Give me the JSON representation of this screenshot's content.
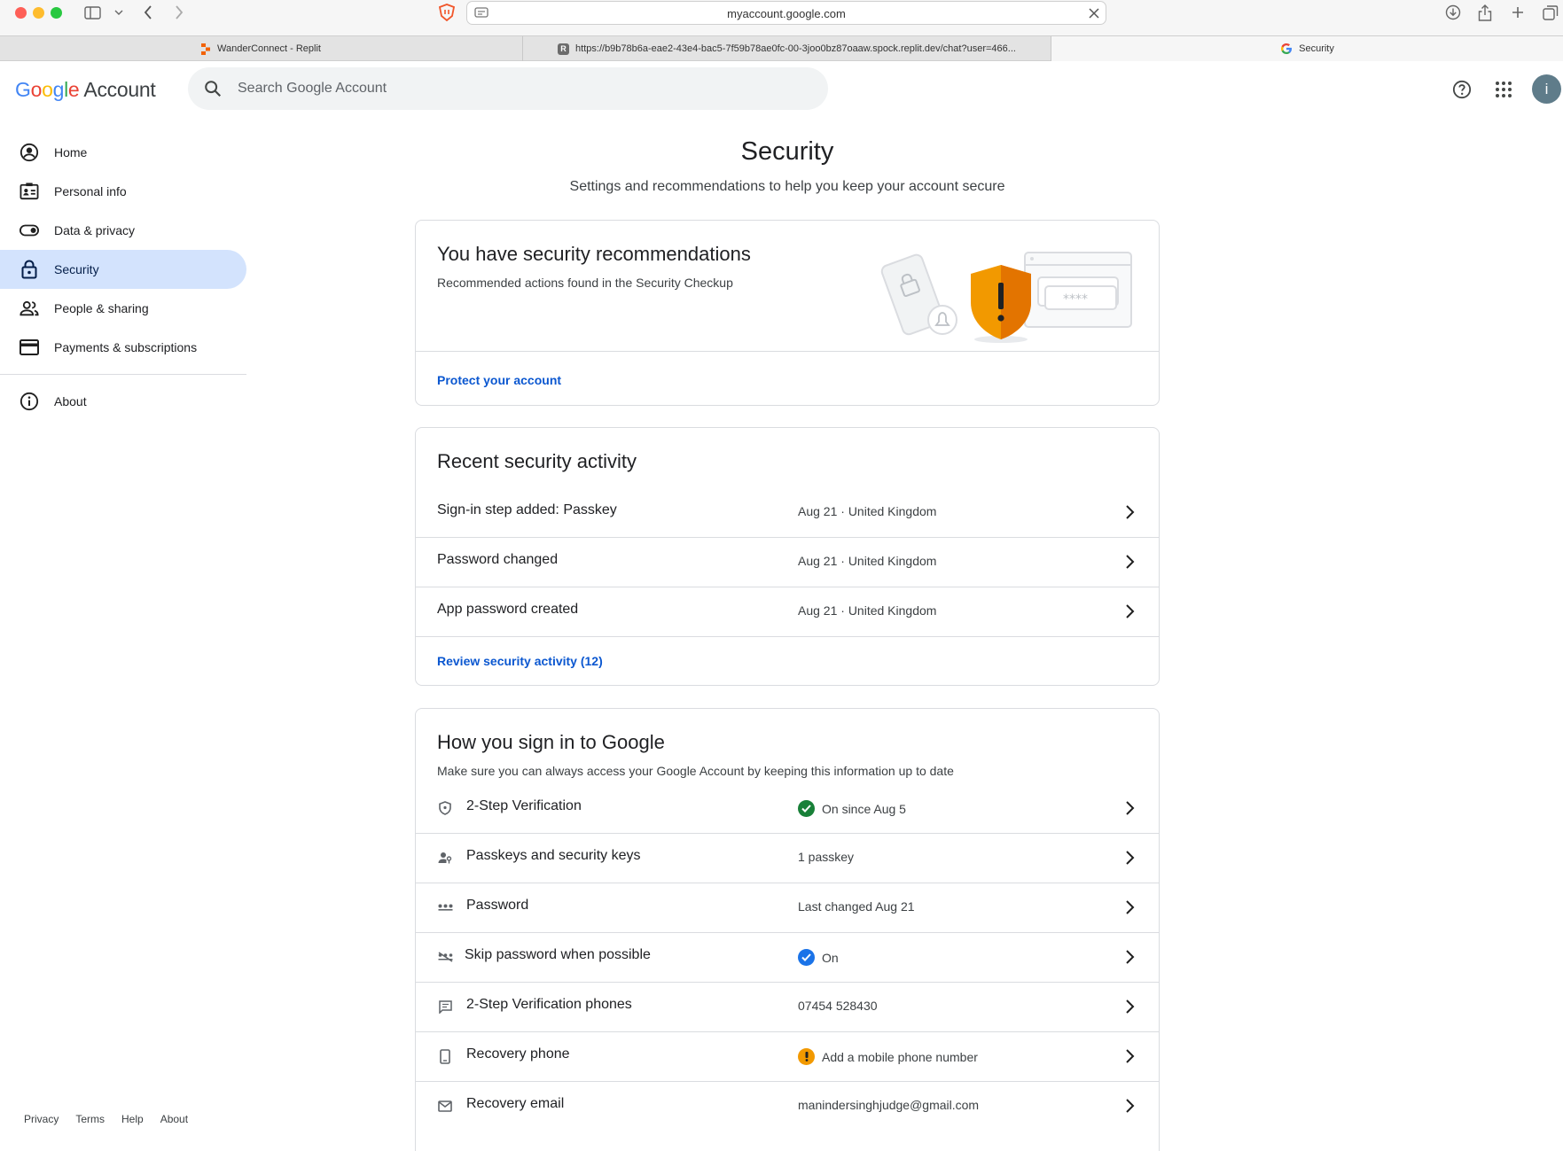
{
  "browser": {
    "url": "myaccount.google.com",
    "tabs": [
      {
        "title": "WanderConnect - Replit"
      },
      {
        "title": "https://b9b78b6a-eae2-43e4-bac5-7f59b78ae0fc-00-3joo0bz87oaaw.spock.replit.dev/chat?user=466..."
      },
      {
        "title": "Security"
      }
    ],
    "replit_tab_glyph": "R"
  },
  "header": {
    "logo_letters": [
      "G",
      "o",
      "o",
      "g",
      "l",
      "e"
    ],
    "logo_suffix": "Account",
    "search_placeholder": "Search Google Account",
    "avatar_initial": "i"
  },
  "sidebar": {
    "items": [
      {
        "label": "Home",
        "icon": "account-circle-icon"
      },
      {
        "label": "Personal info",
        "icon": "id-card-icon"
      },
      {
        "label": "Data & privacy",
        "icon": "toggle-icon"
      },
      {
        "label": "Security",
        "icon": "lock-icon",
        "active": true
      },
      {
        "label": "People & sharing",
        "icon": "people-icon"
      },
      {
        "label": "Payments & subscriptions",
        "icon": "credit-card-icon"
      }
    ],
    "about": {
      "label": "About",
      "icon": "info-icon"
    },
    "footer": [
      "Privacy",
      "Terms",
      "Help",
      "About"
    ]
  },
  "page": {
    "title": "Security",
    "subtitle": "Settings and recommendations to help you keep your account secure"
  },
  "recommendations": {
    "title": "You have security recommendations",
    "description": "Recommended actions found in the Security Checkup",
    "link": "Protect your account",
    "password_mask": "****"
  },
  "activity": {
    "title": "Recent security activity",
    "rows": [
      {
        "label": "Sign-in step added: Passkey",
        "value": "Aug 21 · United Kingdom"
      },
      {
        "label": "Password changed",
        "value": "Aug 21 · United Kingdom"
      },
      {
        "label": "App password created",
        "value": "Aug 21 · United Kingdom"
      }
    ],
    "link": "Review security activity (12)"
  },
  "signin": {
    "title": "How you sign in to Google",
    "description": "Make sure you can always access your Google Account by keeping this information up to date",
    "rows": [
      {
        "label": "2-Step Verification",
        "value": "On since Aug 5",
        "icon": "shield-icon",
        "status": "success"
      },
      {
        "label": "Passkeys and security keys",
        "value": "1 passkey",
        "icon": "person-key-icon",
        "status": "none"
      },
      {
        "label": "Password",
        "value": "Last changed Aug 21",
        "icon": "password-dots-icon",
        "status": "none"
      },
      {
        "label": "Skip password when possible",
        "value": "On",
        "icon": "skip-password-icon",
        "status": "info"
      },
      {
        "label": "2-Step Verification phones",
        "value": "07454 528430",
        "icon": "message-icon",
        "status": "none"
      },
      {
        "label": "Recovery phone",
        "value": "Add a mobile phone number",
        "icon": "phone-icon",
        "status": "warning"
      },
      {
        "label": "Recovery email",
        "value": "manindersinghjudge@gmail.com",
        "icon": "mail-icon",
        "status": "none"
      }
    ]
  },
  "colors": {
    "accent": "#0b57d0",
    "active_nav": "#d3e3fd",
    "success": "#188038",
    "info": "#1a73e8",
    "warning": "#f29900"
  }
}
